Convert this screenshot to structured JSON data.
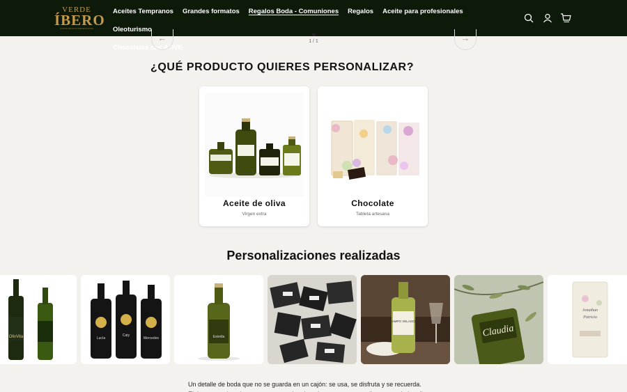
{
  "header": {
    "logo": {
      "line1": "VERDE",
      "line2": "ÍBERO",
      "line3": "ACEITE DE OLIVA VIRGEN EXTRA"
    },
    "nav": [
      {
        "label": "Aceites Tempranos",
        "active": false
      },
      {
        "label": "Grandes formatos",
        "active": false
      },
      {
        "label": "Regalos Boda - Comuniones",
        "active": true
      },
      {
        "label": "Regalos",
        "active": false
      },
      {
        "label": "Aceite para profesionales",
        "active": false
      },
      {
        "label": "Oleoturismo",
        "active": false
      },
      {
        "label": "Chocolates con AOVE",
        "active": false
      }
    ],
    "icons": [
      "search-icon",
      "account-icon",
      "cart-icon"
    ]
  },
  "carousel": {
    "prev_icon": "arrow-left-icon",
    "next_icon": "arrow-right-icon",
    "pager": "1 / 1"
  },
  "personalize": {
    "heading": "¿QUÉ PRODUCTO QUIERES PERSONALIZAR?",
    "cards": [
      {
        "title": "Aceite de oliva",
        "subtitle": "Virgen extra"
      },
      {
        "title": "Chocolate",
        "subtitle": "Tableta artesana"
      }
    ]
  },
  "gallery": {
    "heading": "Personalizaciones realizadas",
    "bottle_labels": {
      "oliviva": "OlivVita",
      "names": [
        "Lucía",
        "Caty",
        "Mercedes"
      ],
      "estrella": "Estrella",
      "campo": "CAMPO VELASCO",
      "claudia": "Claudia",
      "pack": [
        "Jonathan",
        "Patricia"
      ]
    }
  },
  "description": "Un detalle de boda que no se guarda en un cajón: se usa, se disfruta y se recuerda. Elaboramos el aceite en nuestra propia microalmazara y personalizamos cada botella con vuestro nombre,",
  "colors": {
    "header_bg": "#0d1a0a",
    "logo_gold": "#c69a4a",
    "page_bg": "#f4f2ee"
  }
}
